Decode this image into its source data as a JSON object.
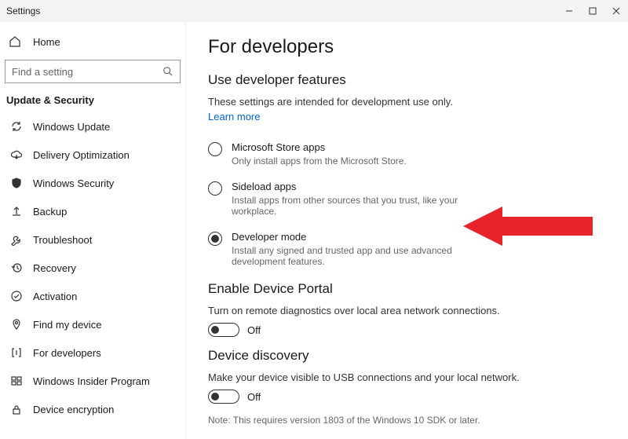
{
  "window": {
    "title": "Settings"
  },
  "sidebar": {
    "home_label": "Home",
    "search_placeholder": "Find a setting",
    "group_title": "Update & Security",
    "items": [
      {
        "label": "Windows Update",
        "icon": "refresh"
      },
      {
        "label": "Delivery Optimization",
        "icon": "cloud-down"
      },
      {
        "label": "Windows Security",
        "icon": "shield"
      },
      {
        "label": "Backup",
        "icon": "upload"
      },
      {
        "label": "Troubleshoot",
        "icon": "wrench"
      },
      {
        "label": "Recovery",
        "icon": "clock-back"
      },
      {
        "label": "Activation",
        "icon": "check-circle"
      },
      {
        "label": "Find my device",
        "icon": "location"
      },
      {
        "label": "For developers",
        "icon": "brackets"
      },
      {
        "label": "Windows Insider Program",
        "icon": "windows"
      },
      {
        "label": "Device encryption",
        "icon": "lock"
      }
    ]
  },
  "main": {
    "title": "For developers",
    "dev_features": {
      "heading": "Use developer features",
      "desc": "These settings are intended for development use only.",
      "learn_more": "Learn more",
      "options": [
        {
          "label": "Microsoft Store apps",
          "desc": "Only install apps from the Microsoft Store.",
          "checked": false
        },
        {
          "label": "Sideload apps",
          "desc": "Install apps from other sources that you trust, like your workplace.",
          "checked": false
        },
        {
          "label": "Developer mode",
          "desc": "Install any signed and trusted app and use advanced development features.",
          "checked": true
        }
      ]
    },
    "device_portal": {
      "heading": "Enable Device Portal",
      "desc": "Turn on remote diagnostics over local area network connections.",
      "state": "Off"
    },
    "device_discovery": {
      "heading": "Device discovery",
      "desc": "Make your device visible to USB connections and your local network.",
      "state": "Off",
      "note": "Note: This requires version 1803 of the Windows 10 SDK or later."
    }
  }
}
